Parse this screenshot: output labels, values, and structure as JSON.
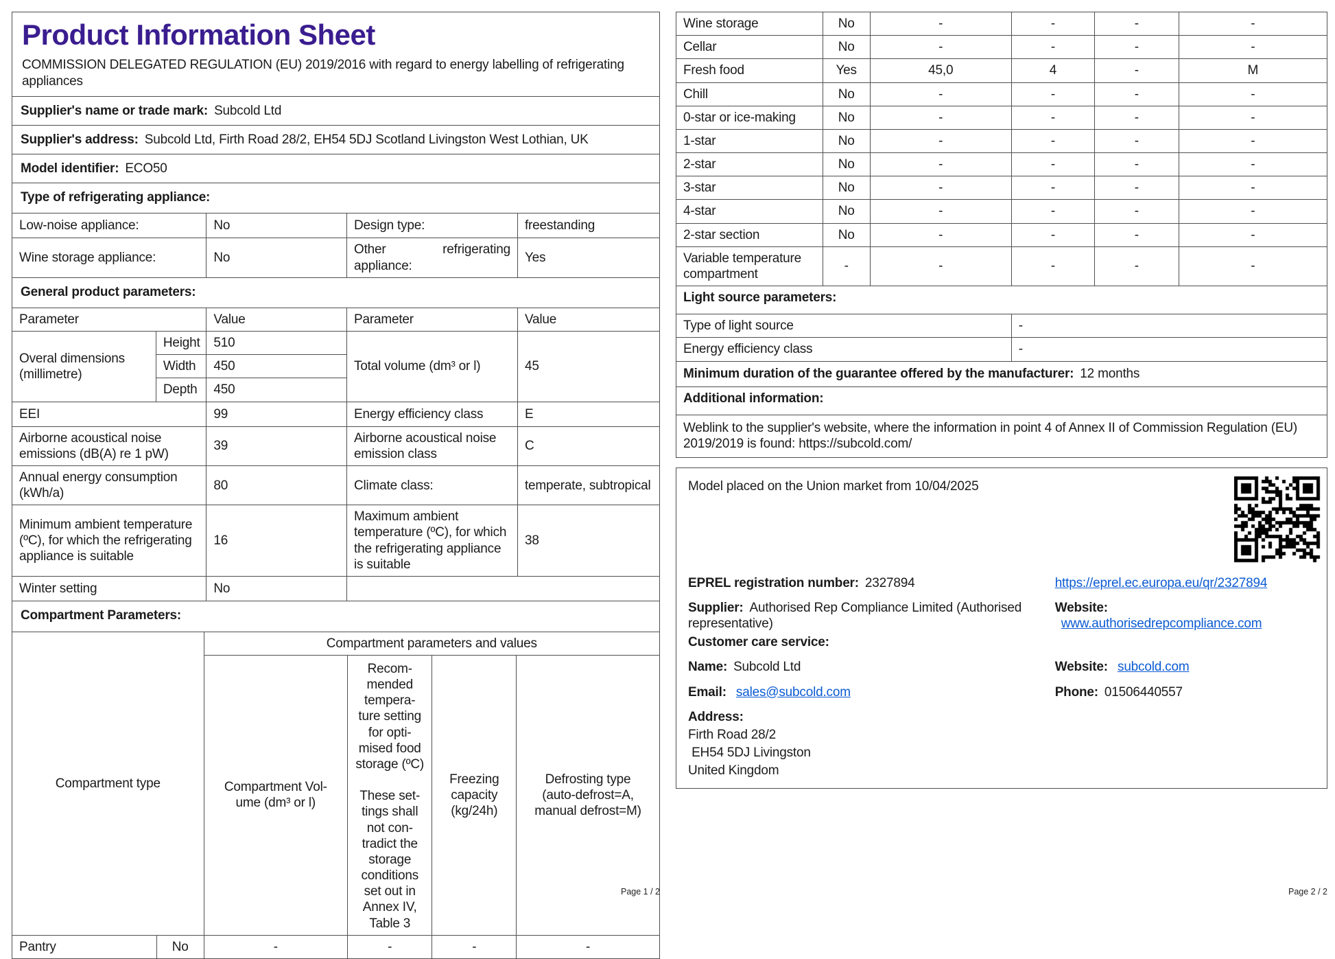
{
  "colors": {
    "title_purple": "#3a1d8f",
    "link_blue": "#0b5bd3",
    "border_gray": "#4f4f4f"
  },
  "page1": {
    "title": "Product Information Sheet",
    "subtitle": "COMMISSION DELEGATED REGULATION (EU) 2019/2016 with regard to energy labelling of refrigerating appliances",
    "supplier_name_label": "Supplier's name or trade mark:",
    "supplier_name": "Subcold Ltd",
    "supplier_address_label": "Supplier's address:",
    "supplier_address": "Subcold Ltd, Firth Road 28/2, EH54 5DJ Scotland Livingston West Lothian, UK",
    "model_label": "Model identifier:",
    "model": "ECO50",
    "type_section": "Type of refrigerating appliance:",
    "type_rows": [
      {
        "p1": "Low-noise appliance:",
        "v1": "No",
        "p2": "Design type:",
        "v2": "freestanding"
      },
      {
        "p1": "Wine storage appliance:",
        "v1": "No",
        "p2": "Other refrigerating appliance:",
        "v2": "Yes"
      }
    ],
    "general_section": "General product parameters:",
    "col_headers": {
      "parameter": "Parameter",
      "value": "Value"
    },
    "dimensions": {
      "label": "Overal dimensions (millimetre)",
      "height_label": "Height",
      "height": "510",
      "width_label": "Width",
      "width": "450",
      "depth_label": "Depth",
      "depth": "450",
      "volume_label": "Total volume (dm³ or l)",
      "volume": "45"
    },
    "param_rows": [
      {
        "p1": "EEI",
        "v1": "99",
        "p2": "Energy efficiency class",
        "v2": "E"
      },
      {
        "p1": "Airborne acoustical noise emissions (dB(A) re 1 pW)",
        "v1": "39",
        "p2": "Airborne acoustical noise emission class",
        "v2": "C"
      },
      {
        "p1": "Annual energy consumption (kWh/a)",
        "v1": "80",
        "p2": "Climate class:",
        "v2": "temperate, subtropical"
      },
      {
        "p1": "Minimum ambient temperature (ºC), for which the refrigerating appliance is suitable",
        "v1": "16",
        "p2": "Maximum ambient temperature (ºC), for which the refrigerating appliance is suitable",
        "v2": "38"
      }
    ],
    "winter_row": {
      "p1": "Winter setting",
      "v1": "No"
    },
    "compartment_section": "Compartment Parameters:",
    "compartment_header": {
      "type": "Compartment type",
      "group": "Compartment parameters and values",
      "volume": "Compartment Vol-\nume (dm³ or l)",
      "temperature": "Recom-\nmended\ntempera-\nture setting\nfor opti-\nmised food\nstorage (ºC)\n\nThese set-\ntings shall\nnot con-\ntradict the\nstorage\nconditions\nset out in\nAnnex IV,\nTable 3",
      "freezing": "Freezing\ncapacity\n(kg/24h)",
      "defrost": "Defrosting type\n(auto-defrost=A,\nmanual defrost=M)"
    },
    "rows": [
      {
        "label": "Pantry",
        "present": "No",
        "volume": "-",
        "temp": "-",
        "freezing": "-",
        "defrost": "-"
      }
    ],
    "footer": "Page 1 / 2"
  },
  "page2": {
    "rows": [
      {
        "label": "Wine storage",
        "present": "No",
        "volume": "-",
        "temp": "-",
        "freezing": "-",
        "defrost": "-"
      },
      {
        "label": "Cellar",
        "present": "No",
        "volume": "-",
        "temp": "-",
        "freezing": "-",
        "defrost": "-"
      },
      {
        "label": "Fresh food",
        "present": "Yes",
        "volume": "45,0",
        "temp": "4",
        "freezing": "-",
        "defrost": "M"
      },
      {
        "label": "Chill",
        "present": "No",
        "volume": "-",
        "temp": "-",
        "freezing": "-",
        "defrost": "-"
      },
      {
        "label": "0-star or ice-making",
        "present": "No",
        "volume": "-",
        "temp": "-",
        "freezing": "-",
        "defrost": "-"
      },
      {
        "label": "1-star",
        "present": "No",
        "volume": "-",
        "temp": "-",
        "freezing": "-",
        "defrost": "-"
      },
      {
        "label": "2-star",
        "present": "No",
        "volume": "-",
        "temp": "-",
        "freezing": "-",
        "defrost": "-"
      },
      {
        "label": "3-star",
        "present": "No",
        "volume": "-",
        "temp": "-",
        "freezing": "-",
        "defrost": "-"
      },
      {
        "label": "4-star",
        "present": "No",
        "volume": "-",
        "temp": "-",
        "freezing": "-",
        "defrost": "-"
      },
      {
        "label": "2-star section",
        "present": "No",
        "volume": "-",
        "temp": "-",
        "freezing": "-",
        "defrost": "-"
      },
      {
        "label": "Variable temperature compartment",
        "present": "-",
        "volume": "-",
        "temp": "-",
        "freezing": "-",
        "defrost": "-"
      }
    ],
    "light_section": "Light source parameters:",
    "light_rows": [
      {
        "label": "Type of light source",
        "value": "-"
      },
      {
        "label": "Energy efficiency class",
        "value": "-"
      }
    ],
    "guarantee_label": "Minimum duration of the guarantee offered by the manufacturer:",
    "guarantee_value": "12 months",
    "additional_section": "Additional information:",
    "weblink_text": "Weblink to the supplier's website, where the information in point 4 of Annex II of Commission Regulation (EU) 2019/2019 is found:  https://subcold.com/",
    "market_box": {
      "market_text": "Model placed on the Union market from 10/04/2025",
      "eprel_label": "EPREL registration number:",
      "eprel_value": "2327894",
      "eprel_link": "https://eprel.ec.europa.eu/qr/2327894",
      "supplier_label": "Supplier:",
      "supplier_value": "Authorised Rep Compliance Limited (Authorised representative)",
      "website_label": "Website:",
      "website_link": "www.authorisedrepcompliance.com",
      "care_section": "Customer care service:",
      "name_label": "Name:",
      "name_value": "Subcold Ltd",
      "care_website_label": "Website:",
      "care_website_link": "subcold.com",
      "email_label": "Email:",
      "email_link": "sales@subcold.com",
      "phone_label": "Phone:",
      "phone_value": "01506440557",
      "address_label": "Address:",
      "address_line1": "Firth Road 28/2",
      "address_line2": " EH54 5DJ Livingston",
      "address_line3": "United Kingdom"
    },
    "footer": "Page 2 / 2"
  }
}
